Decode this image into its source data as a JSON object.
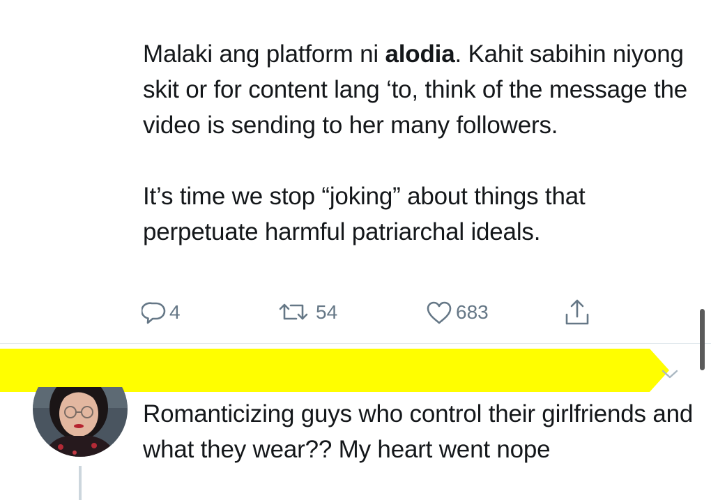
{
  "tweet1": {
    "paragraph1": {
      "before_mention": "Malaki ang platform ni ",
      "mention": "alodia",
      "after_mention": ". Kahit sabihin niyong skit or for content lang ‘to, think of the message the video is sending to her many followers."
    },
    "paragraph2": "It’s time we stop “joking” about things that perpetuate harmful patriarchal ideals.",
    "actions": {
      "reply_count": "4",
      "retweet_count": "54",
      "like_count": "683"
    }
  },
  "tweet2": {
    "text": "Romanticizing guys who control their girlfriends and what they wear?? My heart went nope"
  },
  "colors": {
    "redaction": "#fffe00",
    "icon_gray": "#657786",
    "divider": "#e1e8ed",
    "thread_line": "#ccd6dd"
  },
  "icons": {
    "reply": "reply-icon",
    "retweet": "retweet-icon",
    "like": "heart-icon",
    "share": "share-icon",
    "caret": "chevron-down-icon"
  }
}
